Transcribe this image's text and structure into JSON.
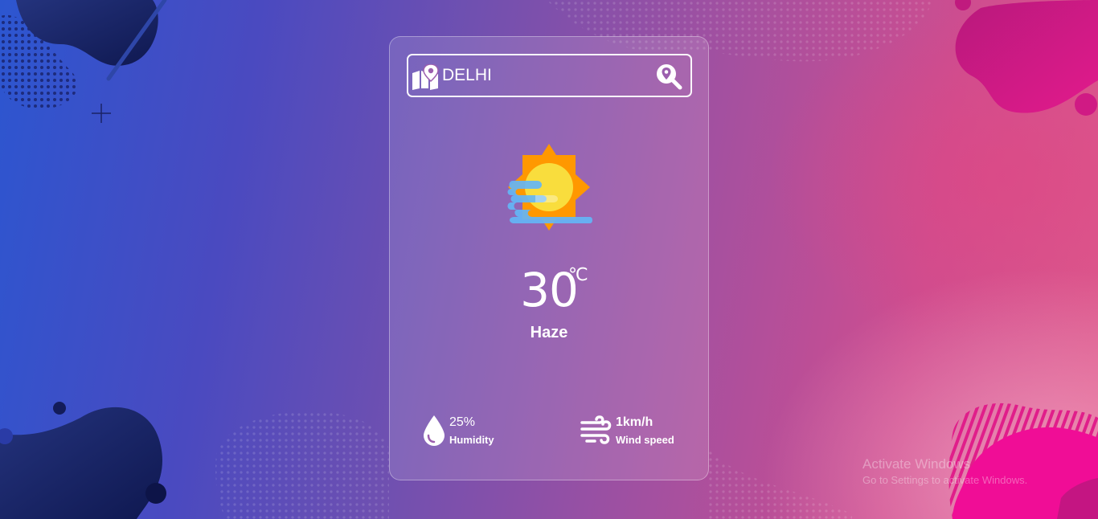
{
  "search": {
    "value": "DELHI",
    "icon": "map-location-icon",
    "button_icon": "search-location-icon"
  },
  "weather": {
    "icon": "sun-haze-icon",
    "temperature": "30",
    "unit": "℃",
    "condition": "Haze"
  },
  "details": {
    "humidity": {
      "value": "25%",
      "label": "Humidity",
      "icon": "water-drop-icon"
    },
    "wind": {
      "value": "1km/h",
      "label": "Wind speed",
      "icon": "wind-icon"
    }
  },
  "watermark": {
    "title": "Activate Windows",
    "subtitle": "Go to Settings to activate Windows."
  },
  "colors": {
    "background_left": "#2c56d0",
    "background_right": "#de5a8c",
    "sun": "#f9dd3d",
    "sun_rays": "#ff9800",
    "cloud": "#64b5f6"
  }
}
